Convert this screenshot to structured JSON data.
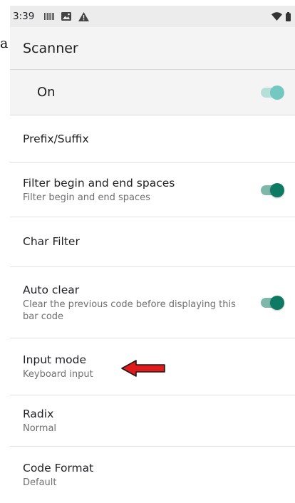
{
  "fragment": "a",
  "status_bar": {
    "time": "3:39"
  },
  "app_bar": {
    "title": "Scanner"
  },
  "master_switch": {
    "label": "On",
    "checked": true
  },
  "preferences": [
    {
      "title": "Prefix/Suffix",
      "summary": ""
    },
    {
      "title": "Filter begin and end spaces",
      "summary": "Filter begin and end spaces",
      "checked": true
    },
    {
      "title": "Char Filter",
      "summary": ""
    },
    {
      "title": "Auto clear",
      "summary": "Clear the previous code before displaying this bar code",
      "checked": true
    },
    {
      "title": "Input mode",
      "summary": "Keyboard input"
    },
    {
      "title": "Radix",
      "summary": "Normal"
    },
    {
      "title": "Code Format",
      "summary": "Default"
    }
  ],
  "colors": {
    "accent": "#0f7a63",
    "master_switch": "#73c8c1",
    "annotation_arrow": "#e01b1b"
  },
  "icons": [
    "barcode-icon",
    "image-icon",
    "warning-icon",
    "wifi-icon",
    "battery-icon",
    "red-arrow-icon"
  ]
}
